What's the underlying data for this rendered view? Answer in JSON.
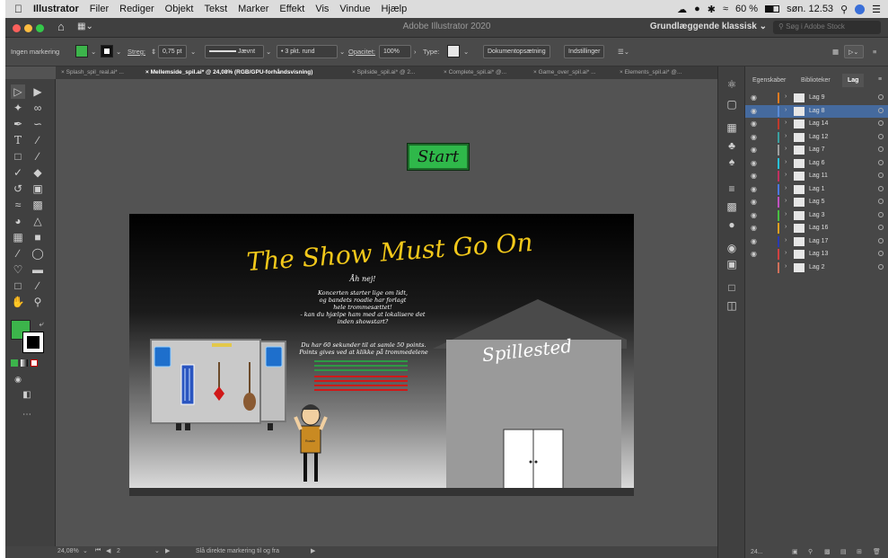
{
  "menubar": {
    "apple": "",
    "items": [
      "Illustrator",
      "Filer",
      "Rediger",
      "Objekt",
      "Tekst",
      "Marker",
      "Effekt",
      "Vis",
      "Vindue",
      "Hjælp"
    ],
    "battery": "60 %",
    "clock": "søn. 12.53"
  },
  "window": {
    "title": "Adobe Illustrator 2020",
    "workspace": "Grundlæggende klassisk",
    "search_placeholder": "Søg i Adobe Stock"
  },
  "control": {
    "selection": "Ingen markering",
    "stroke_label": "Streg:",
    "stroke_value": "0,75 pt",
    "profile": "Jævnt",
    "brush": "3 pkt. rund",
    "opacity_label": "Opacitet:",
    "opacity_value": "100%",
    "type_label": "Type:",
    "doc_setup": "Dokumentopsætning",
    "prefs": "Indstillinger",
    "fill_color": "#3cb44b"
  },
  "tabs": [
    {
      "label": "Splash_spil_real.ai* ..."
    },
    {
      "label": "Mellemside_spil.ai* @ 24,08% (RGB/GPU-forhåndsvisning)"
    },
    {
      "label": "Spilside_spil.ai* @ 2..."
    },
    {
      "label": "Complete_spil.ai* @..."
    },
    {
      "label": "Game_over_spil.ai* ..."
    },
    {
      "label": "Elements_spil.ai* @..."
    }
  ],
  "artwork": {
    "start_button": "Start",
    "title": "The Show Must Go On",
    "intro": "Åh nej!",
    "story": [
      "Koncerten starter lige om lidt,",
      "og bandets roadie har forlagt",
      "hele trommesættet!",
      "- kan du hjælpe ham med at lokalisere det",
      "inden showstart?"
    ],
    "rules": [
      "Du har 60 sekunder til at samle 50 points.",
      "Points gives ved at klikke på trommedelene"
    ],
    "venue_label": "Spillested",
    "shirt_text": "Roadie"
  },
  "status": {
    "zoom": "24,08%",
    "artboard_num": "2",
    "hint": "Slå direkte markering til og fra"
  },
  "layers_panel": {
    "tabs": [
      "Egenskaber",
      "Biblioteker",
      "Lag"
    ],
    "layers": [
      {
        "name": "Lag 9",
        "color": "#e07a20"
      },
      {
        "name": "Lag 8",
        "color": "#5a8bd6"
      },
      {
        "name": "Lag 14",
        "color": "#c0392b"
      },
      {
        "name": "Lag 12",
        "color": "#3aa0a0"
      },
      {
        "name": "Lag 7",
        "color": "#9e9e9e"
      },
      {
        "name": "Lag 6",
        "color": "#27c0d8"
      },
      {
        "name": "Lag 11",
        "color": "#c03060"
      },
      {
        "name": "Lag 1",
        "color": "#4a78e0"
      },
      {
        "name": "Lag 5",
        "color": "#c050c0"
      },
      {
        "name": "Lag 3",
        "color": "#48c040"
      },
      {
        "name": "Lag 16",
        "color": "#e0a020"
      },
      {
        "name": "Lag 17",
        "color": "#2a3ab0"
      },
      {
        "name": "Lag 13",
        "color": "#d04040"
      },
      {
        "name": "Lag 2",
        "color": "#d0705a"
      }
    ],
    "footer": "24..."
  }
}
